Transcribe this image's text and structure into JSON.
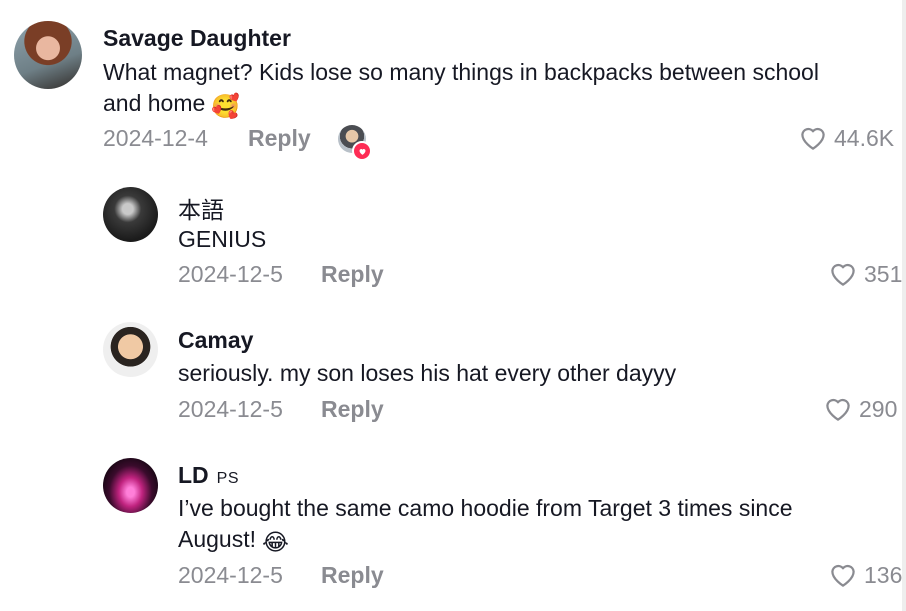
{
  "comments": [
    {
      "author": "Savage Daughter",
      "text_line1": "What magnet? Kids lose so many things in backpacks between school",
      "text_line2": "and home",
      "emoji": "🥰",
      "date": "2024-12-4",
      "reply_label": "Reply",
      "likes": "44.6K"
    },
    {
      "author": "本語",
      "text_line1": "GENIUS",
      "date": "2024-12-5",
      "reply_label": "Reply",
      "likes": "351"
    },
    {
      "author": "Camay",
      "text_line1": "seriously. my son loses his hat every other dayyy",
      "date": "2024-12-5",
      "reply_label": "Reply",
      "likes": "290"
    },
    {
      "author": "LD",
      "badge": "PS",
      "text_line1": "I’ve bought the same camo hoodie from Target 3 times since",
      "text_line2": "August!",
      "emoji": "😂",
      "date": "2024-12-5",
      "reply_label": "Reply",
      "likes": "136"
    }
  ],
  "icons": {
    "like": "heart-outline-icon",
    "creator_liked": "creator-liked-heart-icon"
  },
  "colors": {
    "text": "#161823",
    "muted": "#8a8b91",
    "accent": "#fe2c55"
  }
}
